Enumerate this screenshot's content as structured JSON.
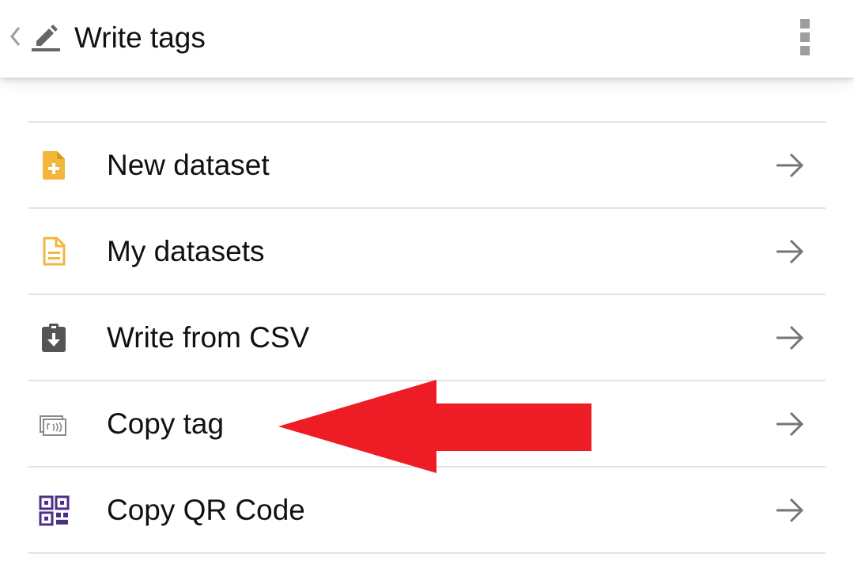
{
  "header": {
    "title": "Write tags",
    "back_icon": "chevron-left-icon",
    "title_icon": "edit-icon",
    "menu_icon": "more-vert-icon"
  },
  "menu": {
    "items": [
      {
        "label": "New dataset",
        "icon": "file-add-icon",
        "icon_color": "#F2B63D"
      },
      {
        "label": "My datasets",
        "icon": "file-text-icon",
        "icon_color": "#F2B63D"
      },
      {
        "label": "Write from CSV",
        "icon": "clipboard-download-icon",
        "icon_color": "#555555"
      },
      {
        "label": "Copy tag",
        "icon": "nfc-card-icon",
        "icon_color": "#8a8a8a"
      },
      {
        "label": "Copy QR Code",
        "icon": "qr-code-icon",
        "icon_color": "#4A2F86"
      }
    ],
    "trailing_icon": "arrow-right-icon"
  },
  "annotation": {
    "arrow_color": "#EE1C25",
    "points_to": "Copy tag"
  }
}
